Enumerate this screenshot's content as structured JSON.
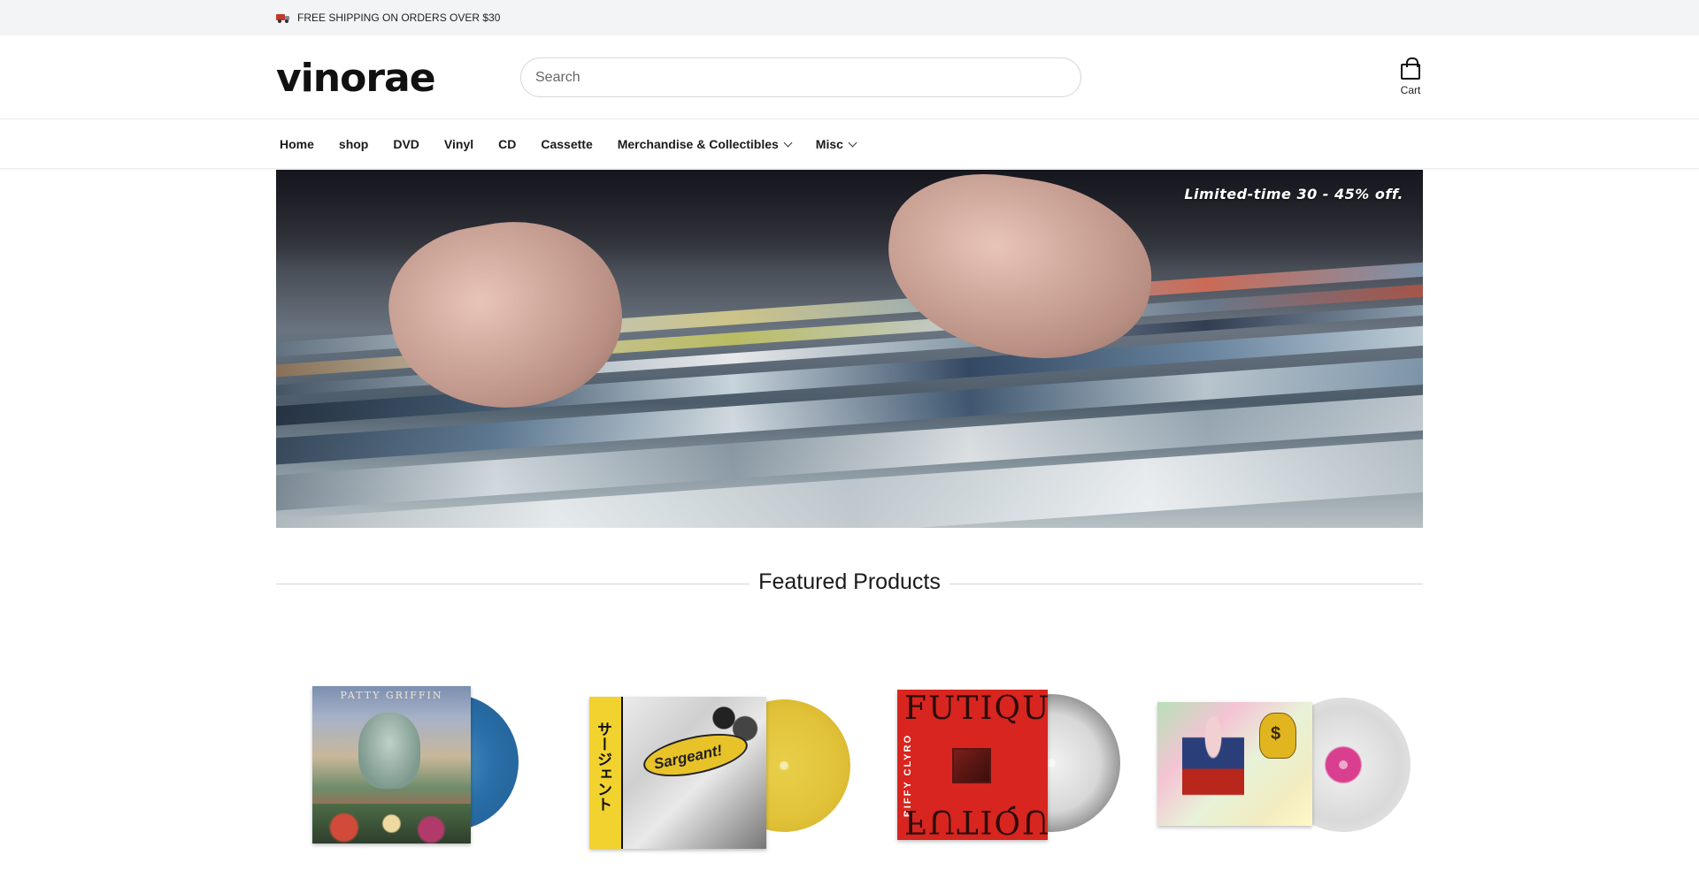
{
  "announcement": {
    "text": "FREE SHIPPING ON ORDERS OVER $30",
    "icon": "truck-icon"
  },
  "header": {
    "logo": "vinorae",
    "search": {
      "placeholder": "Search",
      "value": ""
    },
    "cart_label": "Cart"
  },
  "nav": {
    "items": [
      {
        "label": "Home",
        "dropdown": false
      },
      {
        "label": "shop",
        "dropdown": false
      },
      {
        "label": "DVD",
        "dropdown": false
      },
      {
        "label": "Vinyl",
        "dropdown": false
      },
      {
        "label": "CD",
        "dropdown": false
      },
      {
        "label": "Cassette",
        "dropdown": false
      },
      {
        "label": "Merchandise & Collectibles",
        "dropdown": true
      },
      {
        "label": "Misc",
        "dropdown": true
      }
    ]
  },
  "hero": {
    "text": "Limited-time 30 - 45% off."
  },
  "featured": {
    "title": "Featured Products",
    "products": [
      {
        "cover_text": "PATTY GRIFFIN",
        "disc_color": "#2a6fa8"
      },
      {
        "cover_text": "Sargeant!",
        "obi_text": "サージェント",
        "disc_color": "#e2c33a"
      },
      {
        "cover_text": "FUTIQUE",
        "side_text": "BIFFY CLYRO",
        "disc_color": "#d7d7d7"
      },
      {
        "cover_text": "$",
        "disc_color": "#d93f8e"
      }
    ]
  },
  "colors": {
    "announcement_bg": "#f3f4f6",
    "text": "#1a1a1a"
  }
}
